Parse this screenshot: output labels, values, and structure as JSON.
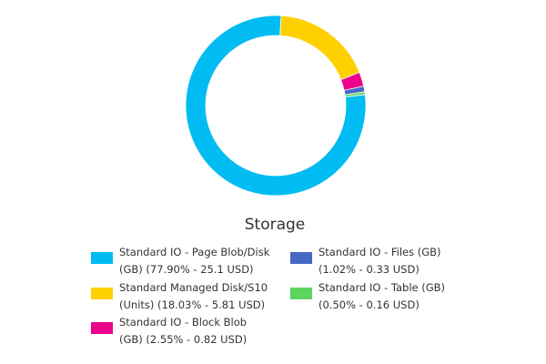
{
  "chart_data": {
    "type": "pie",
    "title": "Storage",
    "legend_position": "bottom",
    "series": [
      {
        "slices": [
          {
            "label_line1": "Standard IO - Page Blob/Disk",
            "label_line2": "(GB) (77.90% - 25.1 USD)",
            "value": 25.1,
            "percent": 77.9,
            "color": "#01bcf2"
          },
          {
            "label_line1": "Standard Managed Disk/S10",
            "label_line2": "(Units) (18.03% - 5.81 USD)",
            "value": 5.81,
            "percent": 18.03,
            "color": "#ffd000"
          },
          {
            "label_line1": "Standard IO - Block Blob",
            "label_line2": "(GB) (2.55% - 0.82 USD)",
            "value": 0.82,
            "percent": 2.55,
            "color": "#ec008c"
          },
          {
            "label_line1": "Standard IO - Files (GB)",
            "label_line2": "(1.02% - 0.33 USD)",
            "value": 0.33,
            "percent": 1.02,
            "color": "#4668c5"
          },
          {
            "label_line1": "Standard IO - Table (GB)",
            "label_line2": "(0.50% - 0.16 USD)",
            "value": 0.16,
            "percent": 0.5,
            "color": "#5bd55f"
          }
        ]
      }
    ]
  }
}
